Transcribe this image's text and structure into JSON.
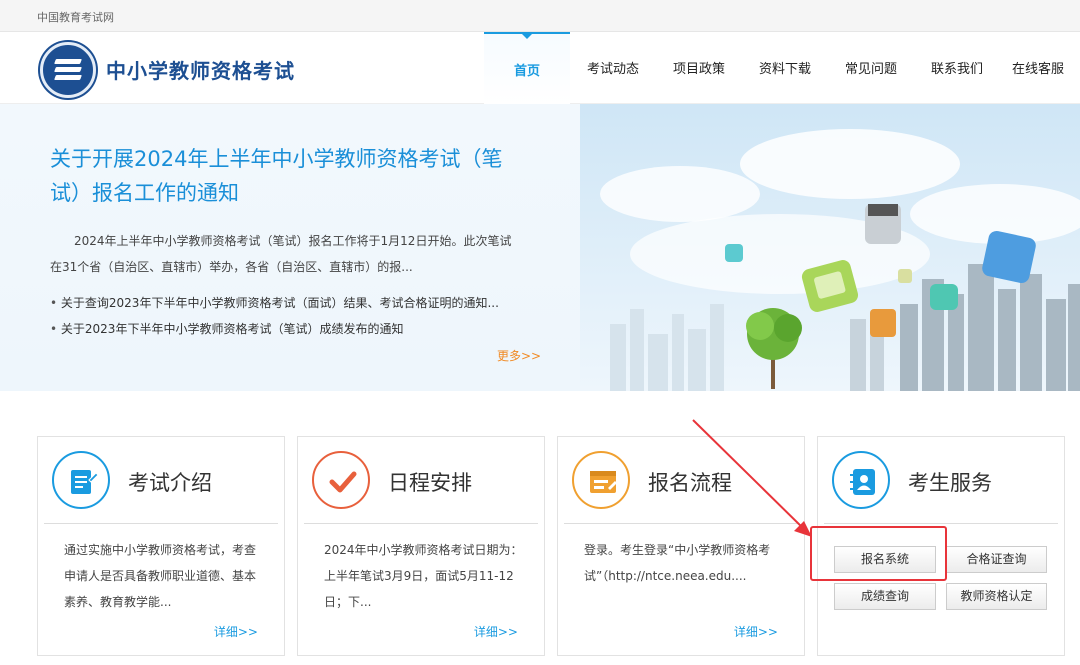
{
  "topbar": {
    "site_name": "中国教育考试网"
  },
  "header": {
    "title": "中小学教师资格考试",
    "nav": [
      {
        "label": "首页",
        "active": true
      },
      {
        "label": "考试动态",
        "active": false
      },
      {
        "label": "项目政策",
        "active": false
      },
      {
        "label": "资料下载",
        "active": false
      },
      {
        "label": "常见问题",
        "active": false
      },
      {
        "label": "联系我们",
        "active": false
      },
      {
        "label": "在线客服",
        "active": false
      }
    ]
  },
  "hero": {
    "title": "关于开展2024年上半年中小学教师资格考试（笔试）报名工作的通知",
    "description": "2024年上半年中小学教师资格考试（笔试）报名工作将于1月12日开始。此次笔试在31个省（自治区、直辖市）举办，各省（自治区、直辖市）的报...",
    "links": [
      "关于查询2023年下半年中小学教师资格考试（面试）结果、考试合格证明的通知...",
      "关于2023年下半年中小学教师资格考试（笔试）成绩发布的通知"
    ],
    "more": "更多>>"
  },
  "cards": [
    {
      "title": "考试介绍",
      "desc": "通过实施中小学教师资格考试，考查申请人是否具备教师职业道德、基本素养、教育教学能...",
      "detail": "详细>>",
      "color": "#1a9be0",
      "icon": "document-edit-icon"
    },
    {
      "title": "日程安排",
      "desc": "2024年中小学教师资格考试日期为：上半年笔试3月9日，面试5月11-12日；下...",
      "detail": "详细>>",
      "color": "#e8603c",
      "icon": "checkmark-icon"
    },
    {
      "title": "报名流程",
      "desc": "登录。考生登录“中小学教师资格考试”（http://ntce.neea.edu....",
      "detail": "详细>>",
      "color": "#f0a030",
      "icon": "browser-form-icon"
    },
    {
      "title": "考生服务",
      "color": "#1a9be0",
      "icon": "address-book-icon"
    }
  ],
  "services": {
    "registration": "报名系统",
    "certificate_query": "合格证查询",
    "score_query": "成绩查询",
    "teacher_certification": "教师资格认定"
  }
}
